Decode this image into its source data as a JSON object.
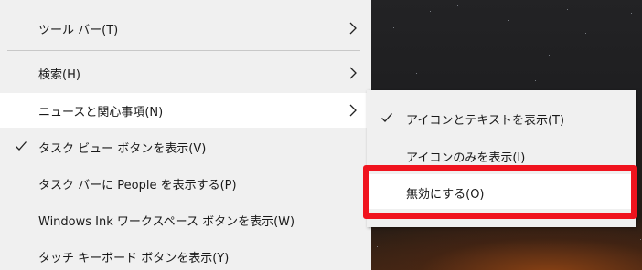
{
  "menu": {
    "items": [
      {
        "label": "ツール バー(T)",
        "has_submenu": true,
        "checked": false
      },
      {
        "label": "検索(H)",
        "has_submenu": true,
        "checked": false
      },
      {
        "label": "ニュースと関心事項(N)",
        "has_submenu": true,
        "checked": false,
        "highlighted": true
      },
      {
        "label": "タスク ビュー ボタンを表示(V)",
        "has_submenu": false,
        "checked": true
      },
      {
        "label": "タスク バーに People を表示する(P)",
        "has_submenu": false,
        "checked": false
      },
      {
        "label": "Windows Ink ワークスペース ボタンを表示(W)",
        "has_submenu": false,
        "checked": false
      },
      {
        "label": "タッチ キーボード ボタンを表示(Y)",
        "has_submenu": false,
        "checked": false
      }
    ]
  },
  "submenu": {
    "items": [
      {
        "label": "アイコンとテキストを表示(T)",
        "checked": true
      },
      {
        "label": "アイコンのみを表示(I)",
        "checked": false
      },
      {
        "label": "無効にする(O)",
        "checked": false,
        "highlighted": true
      }
    ]
  },
  "colors": {
    "menu_bg": "#f0f0f0",
    "hover_bg": "#ffffff",
    "annotation_red": "#f0131e"
  },
  "icons": {
    "chevron": "chevron-right-icon",
    "check": "checkmark-icon"
  }
}
